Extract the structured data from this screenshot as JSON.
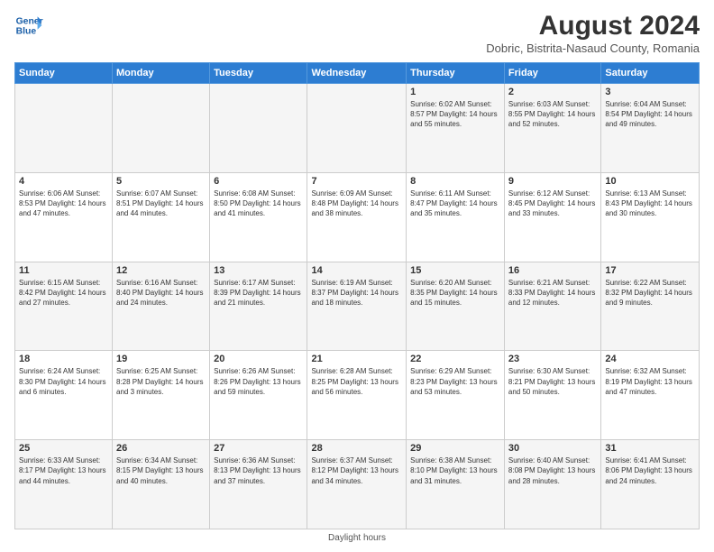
{
  "header": {
    "logo_line1": "General",
    "logo_line2": "Blue",
    "main_title": "August 2024",
    "subtitle": "Dobric, Bistrita-Nasaud County, Romania"
  },
  "columns": [
    "Sunday",
    "Monday",
    "Tuesday",
    "Wednesday",
    "Thursday",
    "Friday",
    "Saturday"
  ],
  "weeks": [
    [
      {
        "day": "",
        "info": ""
      },
      {
        "day": "",
        "info": ""
      },
      {
        "day": "",
        "info": ""
      },
      {
        "day": "",
        "info": ""
      },
      {
        "day": "1",
        "info": "Sunrise: 6:02 AM\nSunset: 8:57 PM\nDaylight: 14 hours\nand 55 minutes."
      },
      {
        "day": "2",
        "info": "Sunrise: 6:03 AM\nSunset: 8:55 PM\nDaylight: 14 hours\nand 52 minutes."
      },
      {
        "day": "3",
        "info": "Sunrise: 6:04 AM\nSunset: 8:54 PM\nDaylight: 14 hours\nand 49 minutes."
      }
    ],
    [
      {
        "day": "4",
        "info": "Sunrise: 6:06 AM\nSunset: 8:53 PM\nDaylight: 14 hours\nand 47 minutes."
      },
      {
        "day": "5",
        "info": "Sunrise: 6:07 AM\nSunset: 8:51 PM\nDaylight: 14 hours\nand 44 minutes."
      },
      {
        "day": "6",
        "info": "Sunrise: 6:08 AM\nSunset: 8:50 PM\nDaylight: 14 hours\nand 41 minutes."
      },
      {
        "day": "7",
        "info": "Sunrise: 6:09 AM\nSunset: 8:48 PM\nDaylight: 14 hours\nand 38 minutes."
      },
      {
        "day": "8",
        "info": "Sunrise: 6:11 AM\nSunset: 8:47 PM\nDaylight: 14 hours\nand 35 minutes."
      },
      {
        "day": "9",
        "info": "Sunrise: 6:12 AM\nSunset: 8:45 PM\nDaylight: 14 hours\nand 33 minutes."
      },
      {
        "day": "10",
        "info": "Sunrise: 6:13 AM\nSunset: 8:43 PM\nDaylight: 14 hours\nand 30 minutes."
      }
    ],
    [
      {
        "day": "11",
        "info": "Sunrise: 6:15 AM\nSunset: 8:42 PM\nDaylight: 14 hours\nand 27 minutes."
      },
      {
        "day": "12",
        "info": "Sunrise: 6:16 AM\nSunset: 8:40 PM\nDaylight: 14 hours\nand 24 minutes."
      },
      {
        "day": "13",
        "info": "Sunrise: 6:17 AM\nSunset: 8:39 PM\nDaylight: 14 hours\nand 21 minutes."
      },
      {
        "day": "14",
        "info": "Sunrise: 6:19 AM\nSunset: 8:37 PM\nDaylight: 14 hours\nand 18 minutes."
      },
      {
        "day": "15",
        "info": "Sunrise: 6:20 AM\nSunset: 8:35 PM\nDaylight: 14 hours\nand 15 minutes."
      },
      {
        "day": "16",
        "info": "Sunrise: 6:21 AM\nSunset: 8:33 PM\nDaylight: 14 hours\nand 12 minutes."
      },
      {
        "day": "17",
        "info": "Sunrise: 6:22 AM\nSunset: 8:32 PM\nDaylight: 14 hours\nand 9 minutes."
      }
    ],
    [
      {
        "day": "18",
        "info": "Sunrise: 6:24 AM\nSunset: 8:30 PM\nDaylight: 14 hours\nand 6 minutes."
      },
      {
        "day": "19",
        "info": "Sunrise: 6:25 AM\nSunset: 8:28 PM\nDaylight: 14 hours\nand 3 minutes."
      },
      {
        "day": "20",
        "info": "Sunrise: 6:26 AM\nSunset: 8:26 PM\nDaylight: 13 hours\nand 59 minutes."
      },
      {
        "day": "21",
        "info": "Sunrise: 6:28 AM\nSunset: 8:25 PM\nDaylight: 13 hours\nand 56 minutes."
      },
      {
        "day": "22",
        "info": "Sunrise: 6:29 AM\nSunset: 8:23 PM\nDaylight: 13 hours\nand 53 minutes."
      },
      {
        "day": "23",
        "info": "Sunrise: 6:30 AM\nSunset: 8:21 PM\nDaylight: 13 hours\nand 50 minutes."
      },
      {
        "day": "24",
        "info": "Sunrise: 6:32 AM\nSunset: 8:19 PM\nDaylight: 13 hours\nand 47 minutes."
      }
    ],
    [
      {
        "day": "25",
        "info": "Sunrise: 6:33 AM\nSunset: 8:17 PM\nDaylight: 13 hours\nand 44 minutes."
      },
      {
        "day": "26",
        "info": "Sunrise: 6:34 AM\nSunset: 8:15 PM\nDaylight: 13 hours\nand 40 minutes."
      },
      {
        "day": "27",
        "info": "Sunrise: 6:36 AM\nSunset: 8:13 PM\nDaylight: 13 hours\nand 37 minutes."
      },
      {
        "day": "28",
        "info": "Sunrise: 6:37 AM\nSunset: 8:12 PM\nDaylight: 13 hours\nand 34 minutes."
      },
      {
        "day": "29",
        "info": "Sunrise: 6:38 AM\nSunset: 8:10 PM\nDaylight: 13 hours\nand 31 minutes."
      },
      {
        "day": "30",
        "info": "Sunrise: 6:40 AM\nSunset: 8:08 PM\nDaylight: 13 hours\nand 28 minutes."
      },
      {
        "day": "31",
        "info": "Sunrise: 6:41 AM\nSunset: 8:06 PM\nDaylight: 13 hours\nand 24 minutes."
      }
    ]
  ],
  "footer": {
    "daylight_label": "Daylight hours"
  }
}
